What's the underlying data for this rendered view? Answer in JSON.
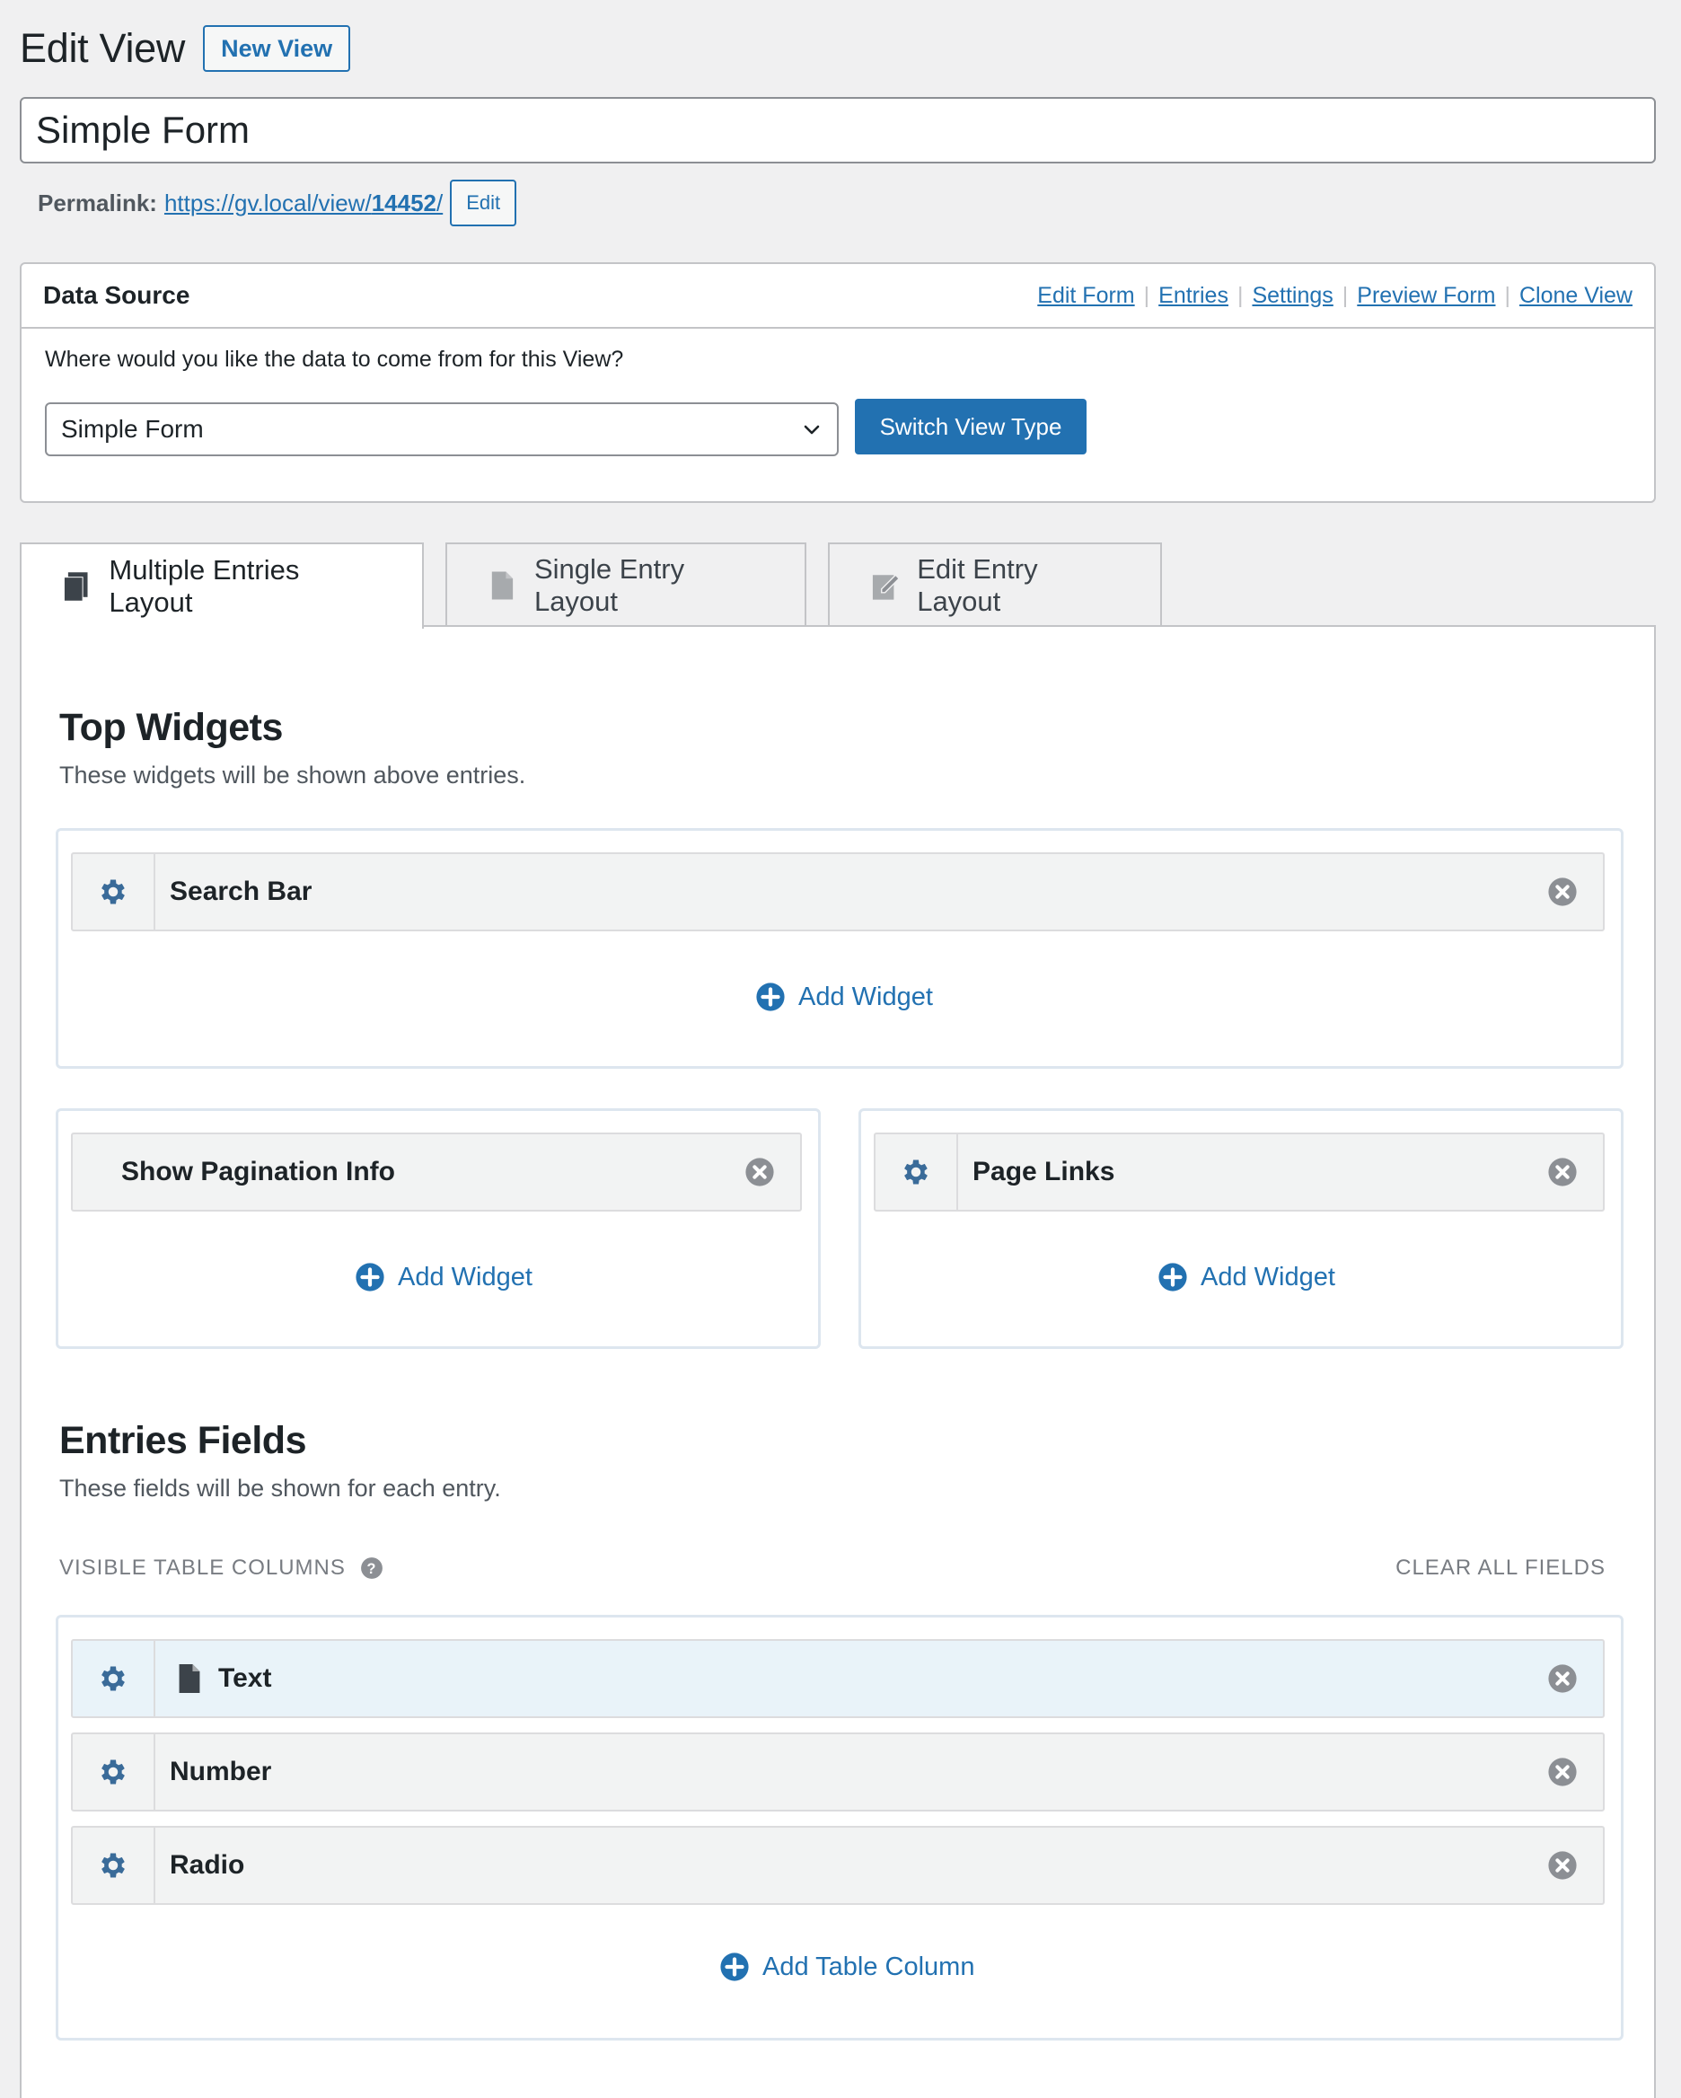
{
  "header": {
    "title": "Edit View",
    "new_view_label": "New View",
    "view_title_value": "Simple Form"
  },
  "permalink": {
    "label": "Permalink:",
    "url_prefix": "https://gv.local/view/",
    "url_id": "14452",
    "url_suffix": "/",
    "edit_label": "Edit"
  },
  "data_source": {
    "title": "Data Source",
    "links": [
      "Edit Form",
      "Entries",
      "Settings",
      "Preview Form",
      "Clone View"
    ],
    "question": "Where would you like the data to come from for this View?",
    "selected_form": "Simple Form",
    "switch_label": "Switch View Type"
  },
  "tabs": [
    {
      "label": "Multiple Entries Layout",
      "active": true
    },
    {
      "label": "Single Entry Layout",
      "active": false
    },
    {
      "label": "Edit Entry Layout",
      "active": false
    }
  ],
  "top_widgets": {
    "title": "Top Widgets",
    "description": "These widgets will be shown above entries.",
    "full_area": {
      "items": [
        "Search Bar"
      ],
      "add_label": "Add Widget"
    },
    "left_area": {
      "items": [
        "Show Pagination Info"
      ],
      "add_label": "Add Widget"
    },
    "right_area": {
      "items": [
        "Page Links"
      ],
      "add_label": "Add Widget"
    }
  },
  "entries_fields": {
    "title": "Entries Fields",
    "description": "These fields will be shown for each entry.",
    "columns_label": "VISIBLE TABLE COLUMNS",
    "clear_label": "CLEAR ALL FIELDS",
    "fields": [
      "Text",
      "Number",
      "Radio"
    ],
    "add_label": "Add Table Column"
  },
  "colors": {
    "accent": "#2271b1",
    "icon": "#3a6b99",
    "remove_icon": "#8c8f94",
    "highlight_row": "#e9f3f9"
  }
}
